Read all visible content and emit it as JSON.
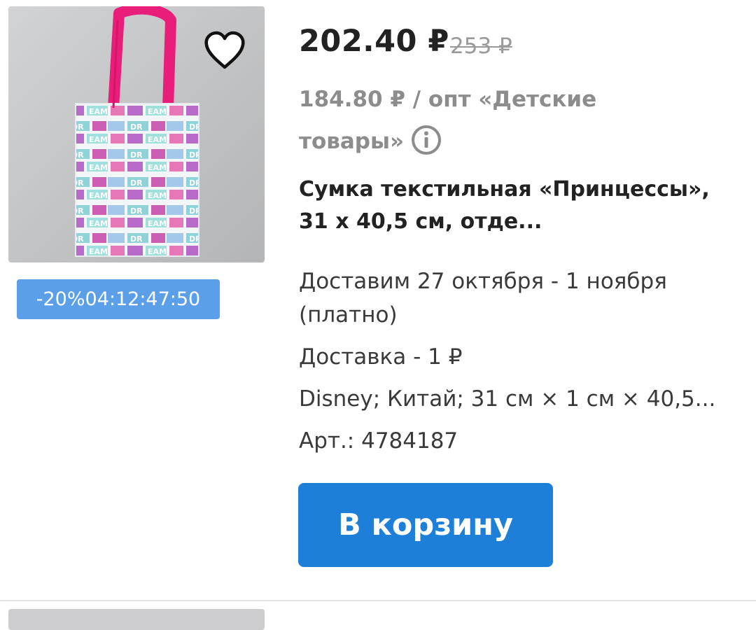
{
  "product": {
    "image_alt": "Сумка текстильная «Принцессы»",
    "bag_print_text": "DREAM",
    "favorite_icon": "heart-outline-icon",
    "promo": {
      "discount": "-20%",
      "timer": "04:12:47:50"
    },
    "price": {
      "current": "202.40 ₽",
      "old": "253 ₽"
    },
    "wholesale": {
      "text": "184.80 ₽ / опт «Детские товары»",
      "info_icon": "info-icon"
    },
    "title": "Сумка текстильная «Принцессы», 31 х 40,5 см, отде...",
    "delivery_dates": "Доставим 27 октября - 1 ноября (платно)",
    "delivery_cost": "Доставка - 1 ₽",
    "attributes": "Disney; Китай; 31 см × 1 см × 40,5...",
    "article": "Арт.: 4784187",
    "cart_button_label": "В корзину"
  },
  "colors": {
    "accent": "#1e7fd9",
    "badge": "#5b9fe8",
    "bag_handle": "#e91e7b"
  }
}
